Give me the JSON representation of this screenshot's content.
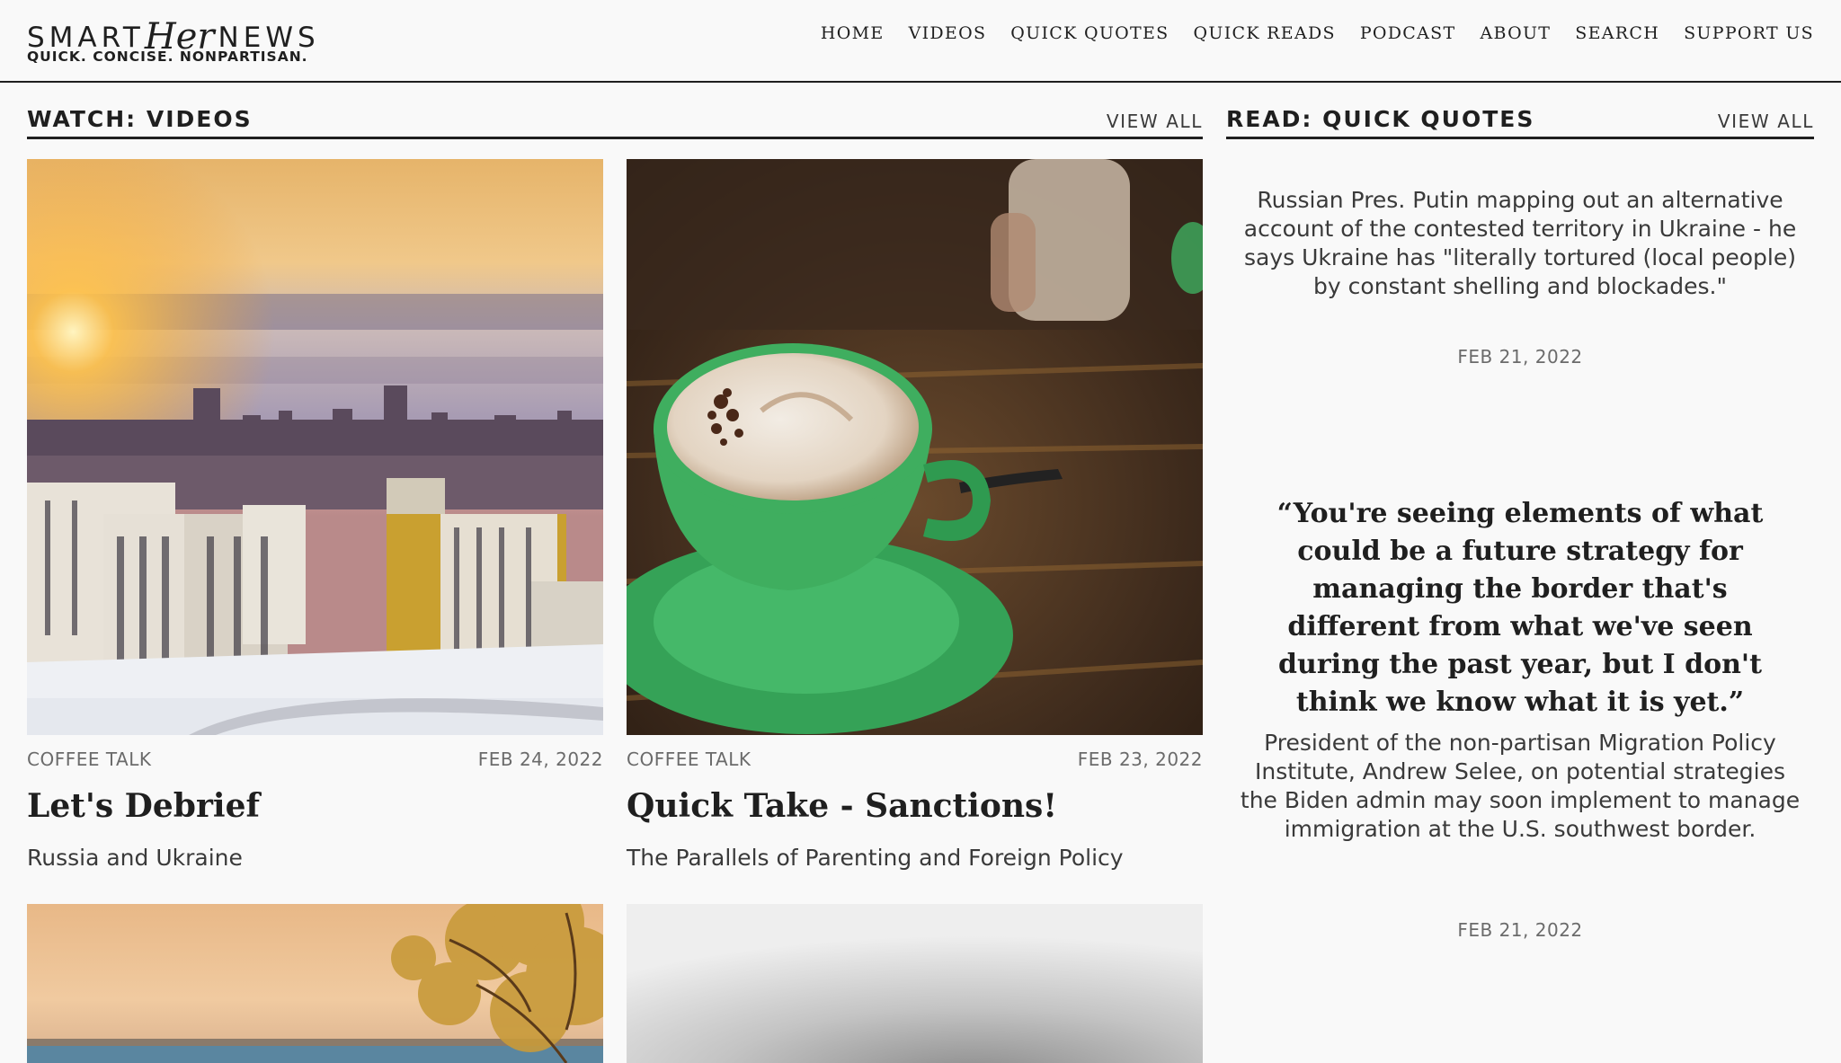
{
  "brand": {
    "name_left": "SMART",
    "name_script": "Her",
    "name_right": "NEWS",
    "tagline": "QUICK. CONCISE. NONPARTISAN."
  },
  "nav": [
    "HOME",
    "VIDEOS",
    "QUICK QUOTES",
    "QUICK READS",
    "PODCAST",
    "ABOUT",
    "SEARCH",
    "SUPPORT US"
  ],
  "videos": {
    "heading": "WATCH: VIDEOS",
    "view_all": "VIEW ALL",
    "cards": [
      {
        "category": "COFFEE TALK",
        "date": "FEB 24, 2022",
        "title": "Let's Debrief",
        "subtitle": "Russia and Ukraine",
        "image": "city-sunset-photo"
      },
      {
        "category": "COFFEE TALK",
        "date": "FEB 23, 2022",
        "title": "Quick Take - Sanctions!",
        "subtitle": "The Parallels of Parenting and Foreign Policy",
        "image": "green-coffee-cup-photo"
      }
    ],
    "more_thumbnails": [
      "lake-autumn-tree-photo",
      "gray-blur-photo"
    ]
  },
  "quotes": {
    "heading": "READ: QUICK QUOTES",
    "view_all": "VIEW ALL",
    "items": [
      {
        "text": "Russian Pres. Putin mapping out an alternative account of the contested territory in Ukraine - he says Ukraine has \"literally tortured (local people) by constant shelling and blockades.\"",
        "date": "FEB 21, 2022"
      },
      {
        "quote": "“You're seeing elements of what could be a future strategy for managing the border that's different from what we've seen during the past year, but I don't think we know what it is yet.”",
        "text": "President of the non-partisan Migration Policy Institute, Andrew Selee, on potential strategies the Biden admin may soon implement to manage immigration at the U.S. southwest border.",
        "date": "FEB 21, 2022"
      }
    ]
  },
  "colors": {
    "text": "#1f1f1f",
    "muted": "#6b6b6b",
    "background": "#f9f9f9",
    "cup_green": "#3fae5f"
  }
}
